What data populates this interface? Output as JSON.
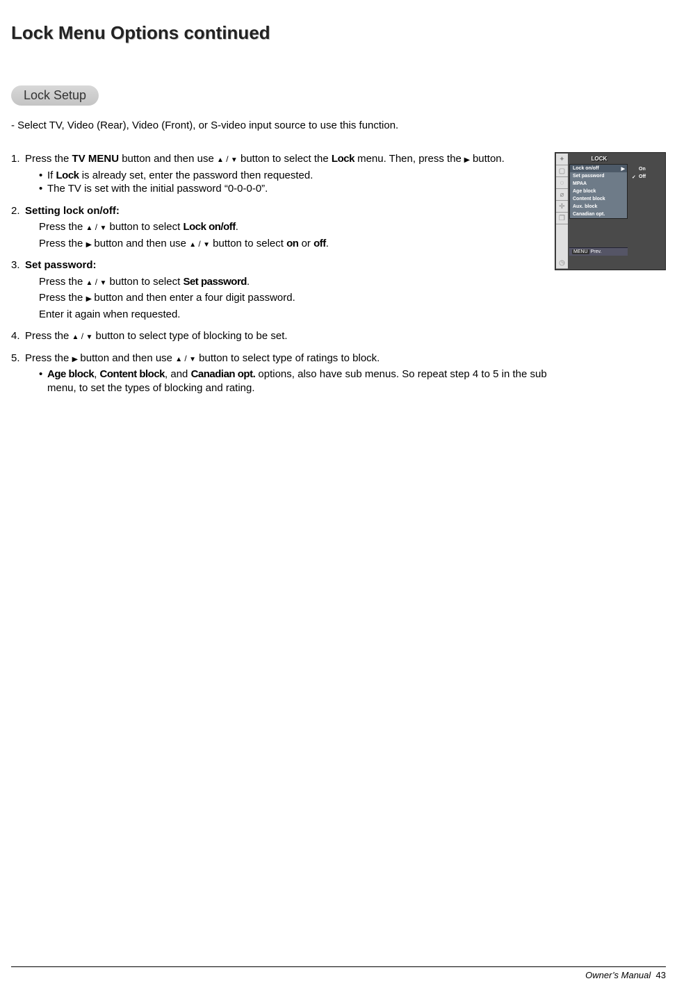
{
  "title": "Lock Menu Options continued",
  "section": "Lock Setup",
  "intro": "-  Select TV, Video (Rear), Video (Front), or S-video input source to use this function.",
  "steps": {
    "s1": {
      "num": "1.",
      "pre": "Press the ",
      "bold1": "TV MENU",
      "mid": " button and then use ",
      "post": " button to select the ",
      "lock": "Lock",
      "end": " menu. Then, press the ",
      "end2": " button.",
      "bul1a": "If ",
      "bul1b": "Lock",
      "bul1c": " is already set, enter the password then requested.",
      "bul2": "The TV is set with the initial password “0-0-0-0”."
    },
    "s2": {
      "num": "2.",
      "head": "Setting lock on/off:",
      "l1a": "Press the ",
      "l1b": " button to select ",
      "l1c": "Lock on/off",
      "l1d": ".",
      "l2a": "Press the ",
      "l2b": " button and then use ",
      "l2c": " button to select ",
      "on": "on",
      "or": " or ",
      "off": "off",
      "l2d": "."
    },
    "s3": {
      "num": "3.",
      "head": "Set password:",
      "l1a": "Press the ",
      "l1b": " button to select ",
      "l1c": "Set password",
      "l1d": ".",
      "l2a": "Press the ",
      "l2b": " button and then enter a four digit password.",
      "l3": "Enter it again when requested."
    },
    "s4": {
      "num": "4.",
      "a": "Press the ",
      "b": " button to select type of blocking to be set."
    },
    "s5": {
      "num": "5.",
      "a": "Press the ",
      "b": " button and then use ",
      "c": " button to select type of ratings to block.",
      "bul_a": "Age block",
      "bul_b": ", ",
      "bul_c": "Content block",
      "bul_d": ", and ",
      "bul_e": "Canadian opt.",
      "bul_f": " options, also have sub menus. So repeat step 4 to 5 in the sub menu, to set the types of blocking and rating."
    }
  },
  "osd": {
    "title": "LOCK",
    "items": [
      "Lock on/off",
      "Set password",
      "MPAA",
      "Age block",
      "Content block",
      "Aux. block",
      "Canadian opt."
    ],
    "opts": [
      "On",
      "Off"
    ],
    "footer_menu": "MENU",
    "footer_prev": "Prev."
  },
  "footer": {
    "label": "Owner’s Manual",
    "page": "43"
  }
}
